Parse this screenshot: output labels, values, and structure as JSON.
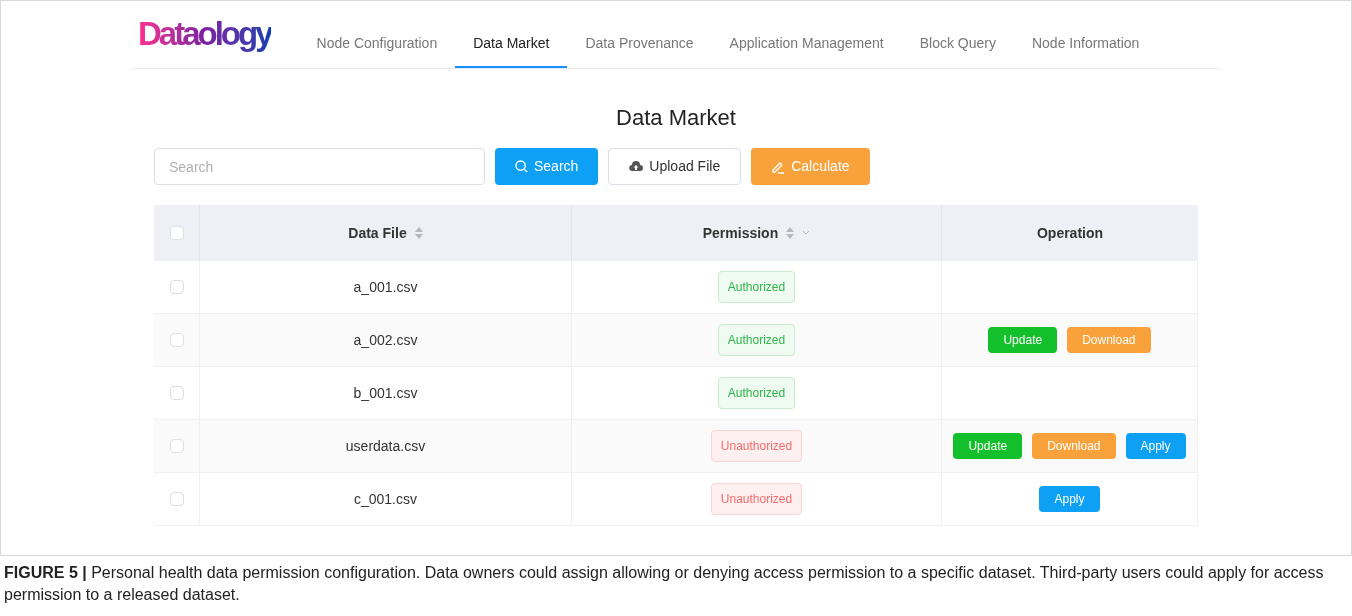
{
  "logo": "Dataology",
  "nav": [
    {
      "label": "Node Configuration",
      "selected": false
    },
    {
      "label": "Data Market",
      "selected": true
    },
    {
      "label": "Data Provenance",
      "selected": false
    },
    {
      "label": "Application Management",
      "selected": false
    },
    {
      "label": "Block Query",
      "selected": false
    },
    {
      "label": "Node Information",
      "selected": false
    }
  ],
  "title": "Data Market",
  "search": {
    "placeholder": "Search"
  },
  "buttons": [
    {
      "kind": "search",
      "label": "Search"
    },
    {
      "kind": "upload",
      "label": "Upload File"
    },
    {
      "kind": "calculate",
      "label": "Calculate"
    }
  ],
  "table": {
    "select_all_checked": false,
    "columns": [
      "Data File",
      "Permission",
      "Operation"
    ],
    "rows": [
      {
        "checked": false,
        "file": "a_001.csv",
        "permission": "Authorized",
        "authorized": true,
        "actions": []
      },
      {
        "checked": false,
        "file": "a_002.csv",
        "permission": "Authorized",
        "authorized": true,
        "actions": [
          {
            "kind": "update",
            "label": "Update"
          },
          {
            "kind": "download",
            "label": "Download"
          }
        ]
      },
      {
        "checked": false,
        "file": "b_001.csv",
        "permission": "Authorized",
        "authorized": true,
        "actions": []
      },
      {
        "checked": false,
        "file": "userdata.csv",
        "permission": "Unauthorized",
        "authorized": false,
        "actions": [
          {
            "kind": "update",
            "label": "Update"
          },
          {
            "kind": "download",
            "label": "Download"
          },
          {
            "kind": "apply",
            "label": "Apply"
          }
        ]
      },
      {
        "checked": false,
        "file": "c_001.csv",
        "permission": "Unauthorized",
        "authorized": false,
        "actions": [
          {
            "kind": "apply",
            "label": "Apply"
          }
        ]
      }
    ]
  },
  "caption": "**FIGURE 5 |** Personal health data permission configuration. Data owners could assign allowing or denying access permission to a specific dataset. Third-party users could apply for access permission to a released dataset."
}
